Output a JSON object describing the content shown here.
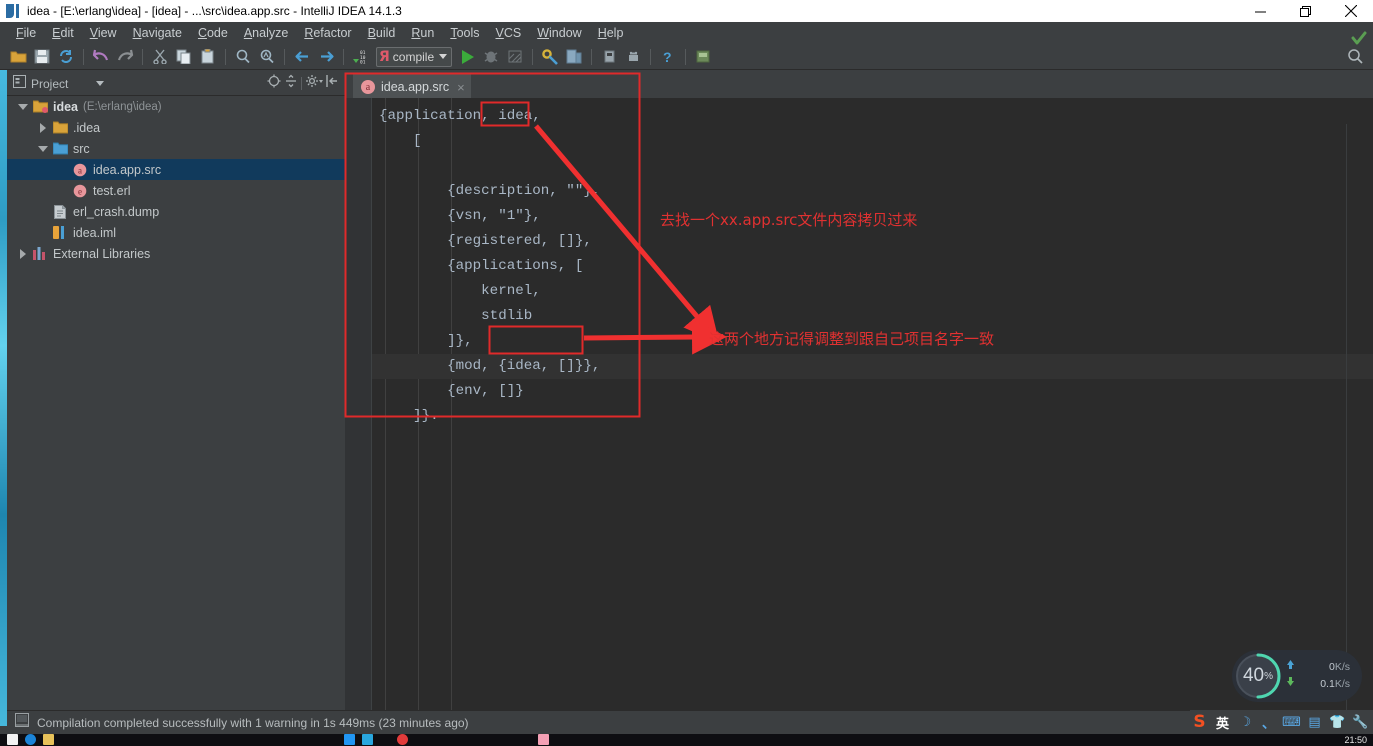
{
  "window": {
    "title": "idea - [E:\\erlang\\idea] - [idea] - ...\\src\\idea.app.src - IntelliJ IDEA 14.1.3",
    "app_icon": "intellij-idea-icon",
    "controls": {
      "minimize": "minimize-button",
      "maximize": "maximize-button",
      "close": "close-button"
    }
  },
  "menubar": {
    "items": [
      {
        "mnemonic": "F",
        "rest": "ile"
      },
      {
        "mnemonic": "E",
        "rest": "dit"
      },
      {
        "mnemonic": "V",
        "rest": "iew"
      },
      {
        "mnemonic": "N",
        "rest": "avigate"
      },
      {
        "mnemonic": "C",
        "rest": "ode"
      },
      {
        "mnemonic": "A",
        "rest": "nalyze"
      },
      {
        "mnemonic": "R",
        "rest": "efactor"
      },
      {
        "mnemonic": "B",
        "rest": "uild"
      },
      {
        "mnemonic": "R",
        "rest": "un"
      },
      {
        "mnemonic": "T",
        "rest": "ools"
      },
      {
        "mnemonic": "V",
        "rest": "CS"
      },
      {
        "mnemonic": "W",
        "rest": "indow"
      },
      {
        "mnemonic": "H",
        "rest": "elp"
      }
    ]
  },
  "toolbar": {
    "run_config_label": "compile",
    "run_config_icon": "erlang-R-icon",
    "icons": [
      "open-folder-icon",
      "save-all-icon",
      "sync-refresh-icon",
      "undo-icon",
      "redo-icon",
      "cut-icon",
      "copy-icon",
      "paste-icon",
      "find-icon",
      "find-replace-icon",
      "back-icon",
      "forward-icon",
      "compile-icon"
    ],
    "icons_right": [
      "run-icon",
      "debug-icon",
      "coverage-icon",
      "settings-wrench-icon",
      "project-structure-icon",
      "android-sdk-icon",
      "android-avd-icon",
      "help-icon",
      "android-monitor-icon"
    ],
    "search_icon": "search-everywhere-icon"
  },
  "project_panel": {
    "title": "Project",
    "title_icon": "project-view-icon",
    "dropdown_icon": "chevron-down-icon",
    "actions": [
      "expand-target-icon",
      "collapse-all-icon",
      "settings-gear-icon",
      "hide-panel-icon"
    ],
    "tree": [
      {
        "label": "idea",
        "sub": "(E:\\erlang\\idea)",
        "icon": "module-folder-icon",
        "depth": 0,
        "state": "expanded",
        "bold": true,
        "selected": false
      },
      {
        "label": ".idea",
        "sub": "",
        "icon": "folder-icon",
        "depth": 1,
        "state": "collapsed",
        "bold": false,
        "selected": false
      },
      {
        "label": "src",
        "sub": "",
        "icon": "source-folder-icon",
        "depth": 1,
        "state": "expanded",
        "bold": false,
        "selected": false
      },
      {
        "label": "idea.app.src",
        "sub": "",
        "icon": "app-src-file-icon",
        "depth": 2,
        "state": "leaf",
        "bold": false,
        "selected": true
      },
      {
        "label": "test.erl",
        "sub": "",
        "icon": "erlang-file-icon",
        "depth": 2,
        "state": "leaf",
        "bold": false,
        "selected": false
      },
      {
        "label": "erl_crash.dump",
        "sub": "",
        "icon": "text-file-icon",
        "depth": 1,
        "state": "leaf",
        "bold": false,
        "selected": false
      },
      {
        "label": "idea.iml",
        "sub": "",
        "icon": "iml-file-icon",
        "depth": 1,
        "state": "leaf",
        "bold": false,
        "selected": false
      },
      {
        "label": "External Libraries",
        "sub": "",
        "icon": "libraries-icon",
        "depth": 0,
        "state": "collapsed",
        "bold": false,
        "selected": false
      }
    ]
  },
  "editor": {
    "tab": {
      "label": "idea.app.src",
      "icon_letter": "a",
      "close_icon": "close-tab-icon"
    },
    "inspection_status_icon": "inspection-ok-check-icon",
    "code_lines": [
      {
        "text": "{application, idea,",
        "caret": false
      },
      {
        "text": "    [",
        "caret": false
      },
      {
        "text": "",
        "caret": false
      },
      {
        "text": "        {description, \"\"},",
        "caret": false
      },
      {
        "text": "        {vsn, \"1\"},",
        "caret": false
      },
      {
        "text": "        {registered, []},",
        "caret": false
      },
      {
        "text": "        {applications, [",
        "caret": false
      },
      {
        "text": "            kernel,",
        "caret": false
      },
      {
        "text": "            stdlib",
        "caret": false
      },
      {
        "text": "        ]},",
        "caret": false
      },
      {
        "text": "        {mod, {idea, []}},",
        "caret": true
      },
      {
        "text": "        {env, []}",
        "caret": false
      },
      {
        "text": "    ]}.",
        "caret": false
      }
    ]
  },
  "annotations": {
    "note_1": "去找一个xx.app.src文件内容拷贝过来",
    "note_2": "这两个地方记得调整到跟自己项目名字一致",
    "color": "#e03131",
    "boxes": [
      "highlight-box-application-name",
      "highlight-box-mod-tuple",
      "highlight-box-editor-region"
    ],
    "arrows": [
      "arrow-to-copy-source",
      "arrow-to-mod-tuple"
    ]
  },
  "statusbar": {
    "icon": "memory-indicator-icon",
    "message": "Compilation completed successfully with 1 warning in 1s 449ms (23 minutes ago)"
  },
  "net_widget": {
    "percent": "40",
    "percent_suffix": "%",
    "upload_icon": "upload-arrow-icon",
    "upload_value": "0",
    "upload_unit": "K/s",
    "download_icon": "download-arrow-icon",
    "download_value": "0.1",
    "download_unit": "K/s",
    "ring_color": "#4fd6b0"
  },
  "tray": {
    "items": [
      {
        "name": "sogou-ime-icon",
        "glyph": "S"
      },
      {
        "name": "ime-language-icon",
        "glyph": "英"
      },
      {
        "name": "ime-moon-icon",
        "glyph": "☽"
      },
      {
        "name": "ime-punctuation-icon",
        "glyph": "、"
      },
      {
        "name": "ime-keyboard-icon",
        "glyph": "⌨"
      },
      {
        "name": "ime-toolbox-icon",
        "glyph": "▤"
      },
      {
        "name": "ime-skin-icon",
        "glyph": "👕"
      },
      {
        "name": "ime-settings-icon",
        "glyph": "🔧"
      }
    ]
  },
  "taskbar": {
    "clock": "21:50",
    "items": [
      "start-button",
      "browser-icon",
      "explorer-icon",
      "app-icon-1",
      "app-icon-2",
      "record-icon",
      "app-icon-3"
    ]
  }
}
